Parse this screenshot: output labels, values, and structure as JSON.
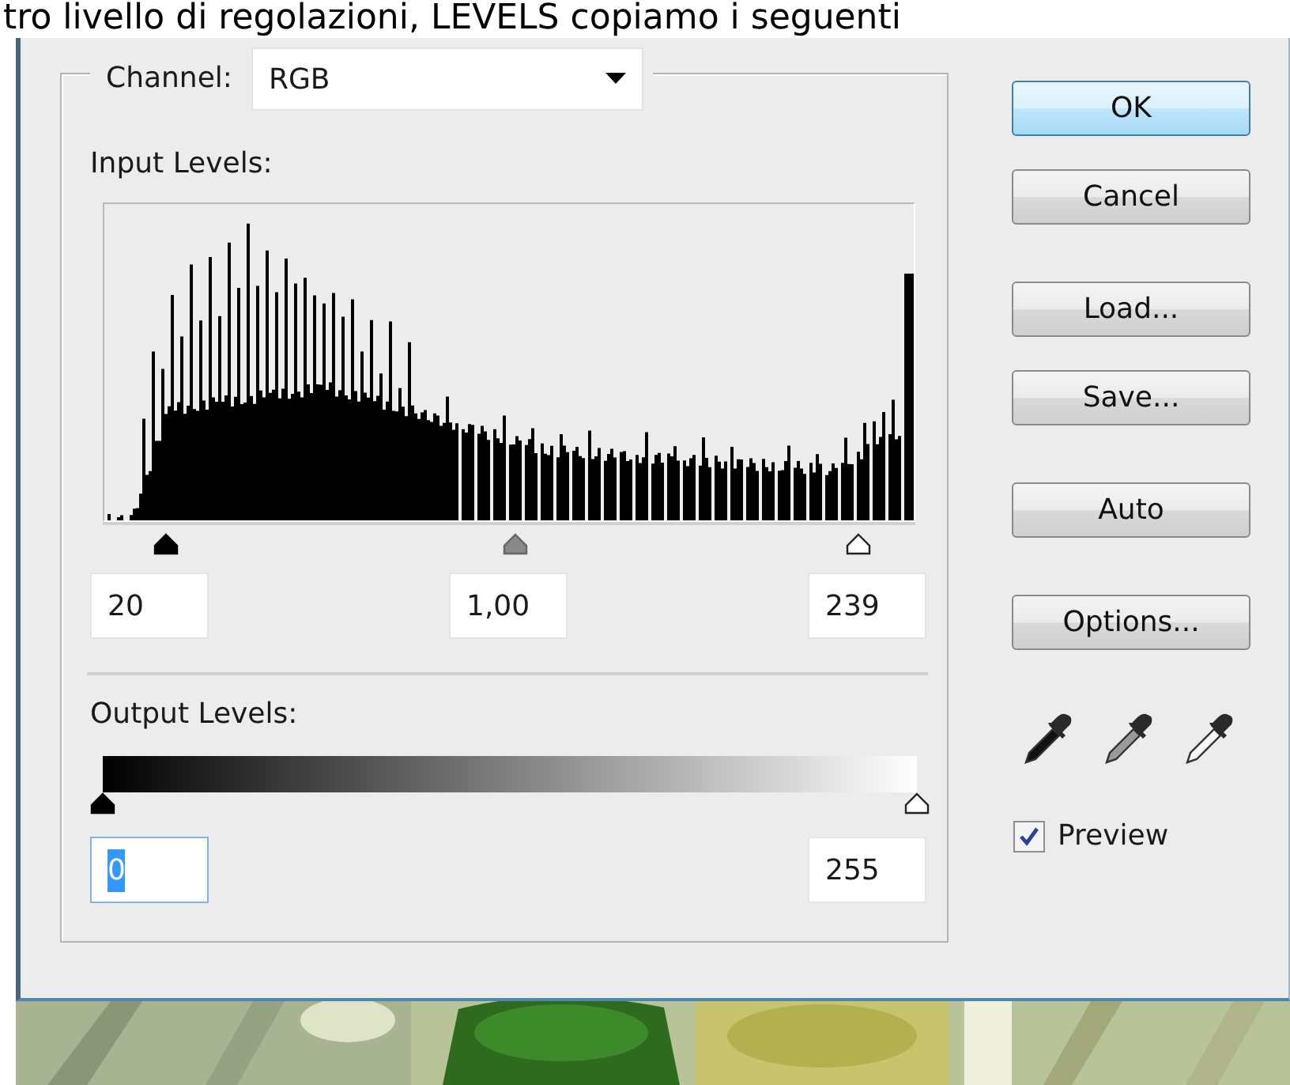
{
  "caption": "tro livello di regolazioni, LEVELS copiamo i seguenti",
  "dialog": {
    "channel": {
      "label": "Channel:",
      "value": "RGB"
    },
    "input_levels": {
      "label": "Input Levels:",
      "sliders": [
        {
          "kind": "black",
          "level": 0.078
        },
        {
          "kind": "gray",
          "level": 0.507
        },
        {
          "kind": "white",
          "level": 0.93
        }
      ],
      "fields": [
        {
          "value": "20"
        },
        {
          "value": "1,00"
        },
        {
          "value": "239"
        }
      ]
    },
    "output_levels": {
      "label": "Output Levels:",
      "sliders": [
        {
          "kind": "black",
          "level": 0.0
        },
        {
          "kind": "white",
          "level": 1.0
        }
      ],
      "fields": [
        {
          "value": "0",
          "highlighted": true
        },
        {
          "value": "255",
          "highlighted": false
        }
      ]
    },
    "buttons": [
      {
        "label": "OK",
        "default": true
      },
      {
        "label": "Cancel",
        "default": false
      },
      {
        "label": "Load...",
        "default": false
      },
      {
        "label": "Save...",
        "default": false
      },
      {
        "label": "Auto",
        "default": false
      },
      {
        "label": "Options...",
        "default": false
      }
    ],
    "eyedroppers": [
      {
        "kind": "black"
      },
      {
        "kind": "gray"
      },
      {
        "kind": "white"
      }
    ],
    "preview": {
      "label": "Preview",
      "checked": true
    }
  }
}
